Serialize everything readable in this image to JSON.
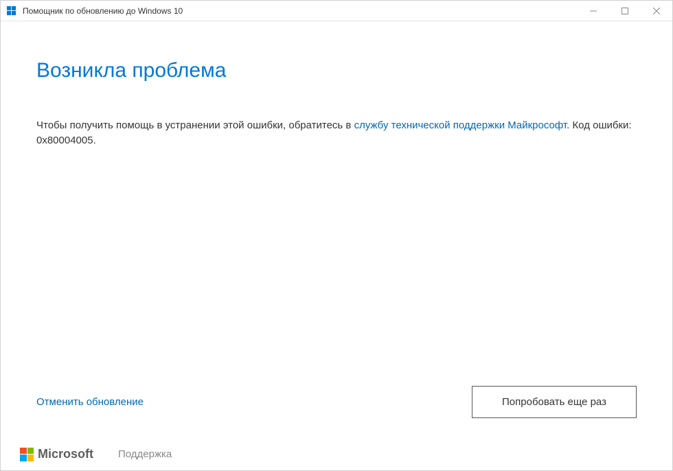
{
  "window": {
    "title": "Помощник по обновлению до Windows 10"
  },
  "content": {
    "heading": "Возникла проблема",
    "message_before_link": "Чтобы получить помощь в устранении этой ошибки, обратитесь в ",
    "link_text": "службу технической поддержки Майкрософт",
    "message_after_link": ". Код ошибки: 0x80004005."
  },
  "actions": {
    "cancel": "Отменить обновление",
    "retry": "Попробовать еще раз"
  },
  "footer": {
    "brand": "Microsoft",
    "support": "Поддержка"
  }
}
